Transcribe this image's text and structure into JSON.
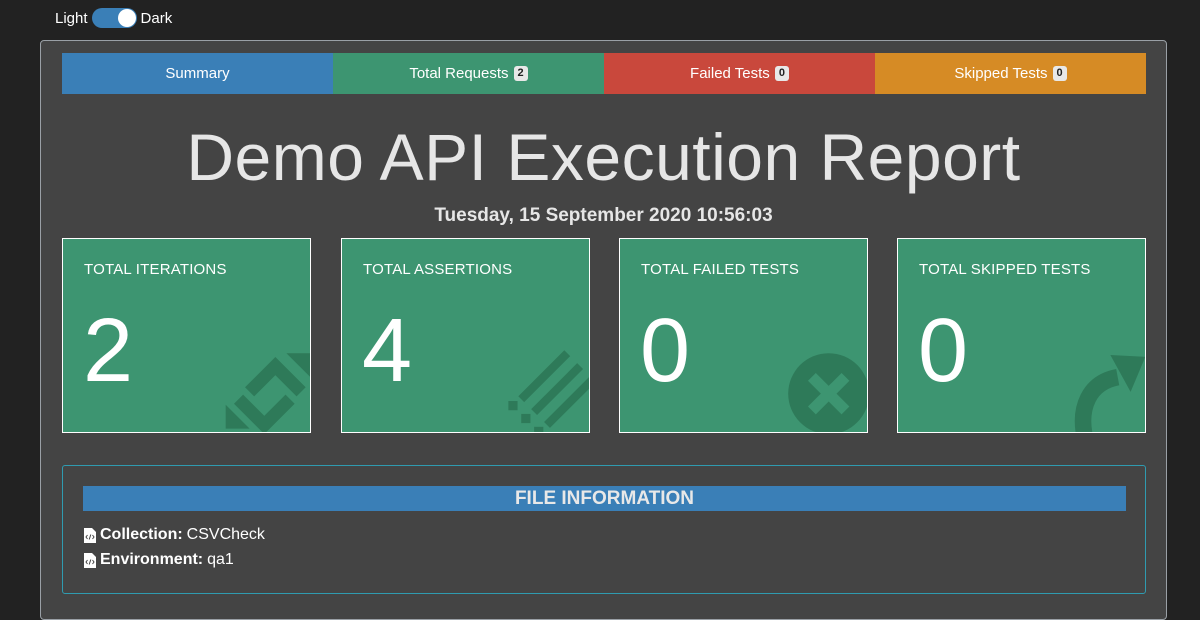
{
  "theme_toggle": {
    "light_label": "Light",
    "dark_label": "Dark",
    "state": "dark"
  },
  "tabs": [
    {
      "label": "Summary",
      "badge": null,
      "color": "#3a7fb7"
    },
    {
      "label": "Total Requests",
      "badge": "2",
      "color": "#3d9571"
    },
    {
      "label": "Failed Tests",
      "badge": "0",
      "color": "#c9483c"
    },
    {
      "label": "Skipped Tests",
      "badge": "0",
      "color": "#d68b25"
    }
  ],
  "report": {
    "title": "Demo API Execution Report",
    "date": "Tuesday, 15 September 2020 10:56:03"
  },
  "cards": [
    {
      "label": "TOTAL ITERATIONS",
      "value": "2",
      "icon": "repeat-icon"
    },
    {
      "label": "TOTAL ASSERTIONS",
      "value": "4",
      "icon": "assertions-icon"
    },
    {
      "label": "TOTAL FAILED TESTS",
      "value": "0",
      "icon": "times-circle-icon"
    },
    {
      "label": "TOTAL SKIPPED TESTS",
      "value": "0",
      "icon": "share-arrow-icon"
    }
  ],
  "file_info": {
    "header": "FILE INFORMATION",
    "collection_key": "Collection:",
    "collection_value": "CSVCheck",
    "environment_key": "Environment:",
    "environment_value": "qa1"
  }
}
